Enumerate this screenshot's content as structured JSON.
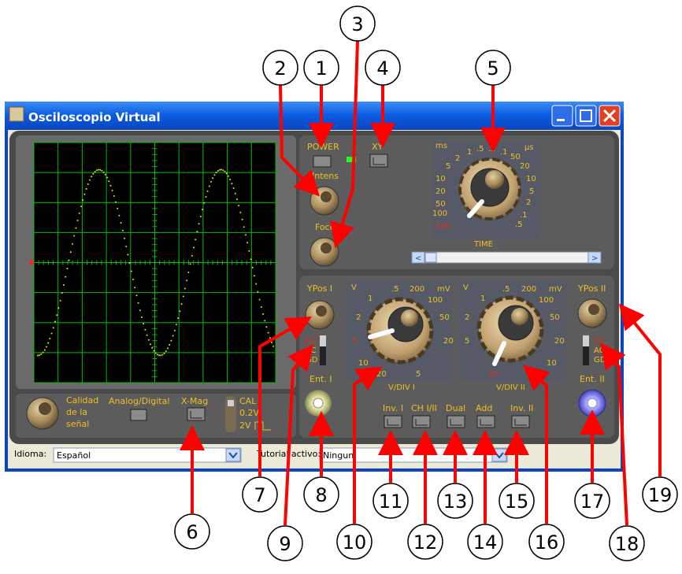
{
  "window": {
    "title": "Osciloscopio Virtual",
    "minimize_glyph": "_",
    "maximize_glyph": "□",
    "close_glyph": "✕"
  },
  "controls": {
    "power": "POWER",
    "xy": "XY",
    "intens": "Intens",
    "foco": "Foco",
    "ypos1": "YPos I",
    "ypos2": "YPos II",
    "ent1": "Ent. I",
    "ent2": "Ent. II",
    "dc": "DC",
    "ac": "AC",
    "gd": "GD",
    "calidad": [
      "Calidad",
      "de la",
      "señal"
    ],
    "analog_digital": "Analog/Digital",
    "xmag": "X-Mag",
    "cal": "CAL",
    "cal_02": "0.2V",
    "cal_2v": "2V",
    "inv1": "Inv. I",
    "ch12": "CH I/II",
    "dual": "Dual",
    "add": "Add",
    "inv2": "Inv. II"
  },
  "time_dial": {
    "title": "TIME",
    "unit_left": "ms",
    "unit_right": "µs",
    "labels_top": [
      "1",
      ".5",
      ".2",
      ".1"
    ],
    "labels_left": [
      "2",
      "5",
      "10",
      "20",
      "50",
      "100"
    ],
    "labels_right": [
      "50",
      "20",
      "10",
      "5",
      "2",
      ".1",
      ".5"
    ],
    "label_red": "200"
  },
  "vdiv1": {
    "title": "V/DIV I",
    "unit_left": "V",
    "unit_right": "mV",
    "labels": [
      "1",
      ".5",
      "200",
      "100",
      "2",
      "50",
      "20",
      "10",
      "20",
      "5"
    ],
    "label_red": "5"
  },
  "vdiv2": {
    "title": "V/DIV II",
    "unit_left": "V",
    "unit_right": "mV",
    "labels": [
      "1",
      ".5",
      "200",
      "100",
      "2",
      "50",
      "5",
      "20",
      "10",
      "5"
    ],
    "label_red": "20"
  },
  "bottom_bar": {
    "idioma_label": "Idioma:",
    "idioma_value": "Español",
    "tutorial_label": "Tutorial activo:",
    "tutorial_value": "Ningun"
  },
  "callouts": [
    "1",
    "2",
    "3",
    "4",
    "5",
    "6",
    "7",
    "8",
    "9",
    "10",
    "11",
    "12",
    "13",
    "14",
    "15",
    "16",
    "17",
    "18",
    "19"
  ],
  "colors": {
    "screen_bg": "#000000",
    "grid": "#00c000",
    "trace": "#e8e800",
    "panel": "#5c5c5c",
    "label_yellow": "#f0c020",
    "arrow_red": "#ff0000",
    "titlebar": "#0a55e0"
  }
}
